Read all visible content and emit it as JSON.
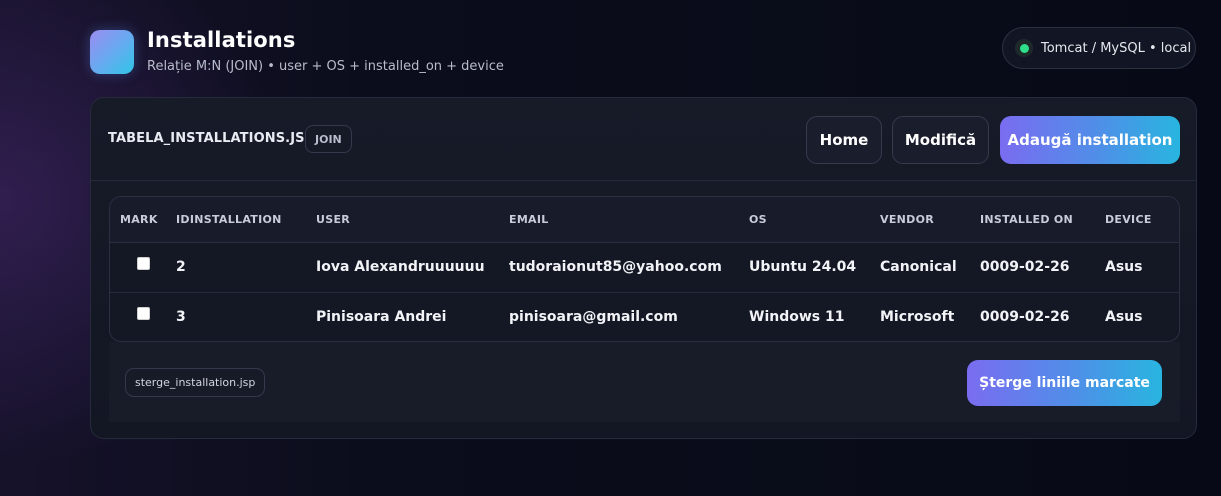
{
  "header": {
    "title": "Installations",
    "subtitle": "Relație M:N (JOIN) • user + OS + installed_on + device",
    "env_label": "Tomcat / MySQL • local",
    "env_status_color": "#2ee08a"
  },
  "card": {
    "file_label": "TABELA_INSTALLATIONS.JSP",
    "badge": "JOIN",
    "buttons": {
      "home": "Home",
      "edit": "Modifică",
      "add": "Adaugă installation"
    }
  },
  "table": {
    "columns": [
      "MARK",
      "IDINSTALLATION",
      "USER",
      "EMAIL",
      "OS",
      "VENDOR",
      "INSTALLED ON",
      "DEVICE"
    ],
    "rows": [
      {
        "id": "2",
        "user": "Iova Alexandruuuuuu",
        "email": "tudoraionut85@yahoo.com",
        "os": "Ubuntu 24.04",
        "vendor": "Canonical",
        "installed_on": "0009-02-26",
        "device": "Asus",
        "marked": false
      },
      {
        "id": "3",
        "user": "Pinisoara Andrei",
        "email": "pinisoara@gmail.com",
        "os": "Windows 11",
        "vendor": "Microsoft",
        "installed_on": "0009-02-26",
        "device": "Asus",
        "marked": false
      }
    ]
  },
  "footer": {
    "file_label": "sterge_installation.jsp",
    "delete_button": "Șterge liniile marcate"
  },
  "colors": {
    "accent_gradient_start": "#7a6cf0",
    "accent_gradient_end": "#28b5df",
    "background": "#070a16"
  }
}
